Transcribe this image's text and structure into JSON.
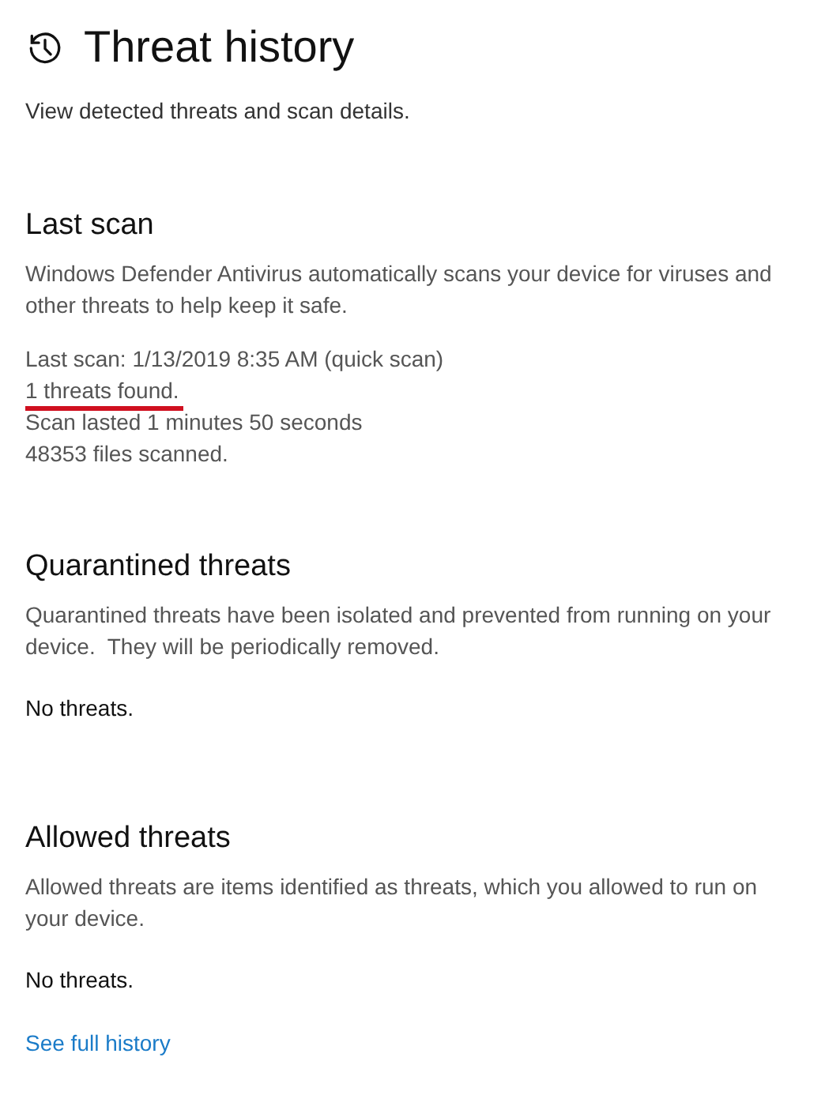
{
  "page": {
    "title": "Threat history",
    "subtitle": "View detected threats and scan details."
  },
  "last_scan": {
    "heading": "Last scan",
    "description": "Windows Defender Antivirus automatically scans your device for viruses and other threats to help keep it safe.",
    "details": [
      {
        "text": "Last scan: 1/13/2019 8:35 AM (quick scan)",
        "highlighted": false
      },
      {
        "text": "1 threats found.",
        "highlighted": true
      },
      {
        "text": "Scan lasted 1 minutes 50 seconds",
        "highlighted": false
      },
      {
        "text": "48353 files scanned.",
        "highlighted": false
      }
    ]
  },
  "quarantined_threats": {
    "heading": "Quarantined threats",
    "description": "Quarantined threats have been isolated and prevented from running on your device.  They will be periodically removed.",
    "status": "No threats."
  },
  "allowed_threats": {
    "heading": "Allowed threats",
    "description": "Allowed threats are items identified as threats, which you allowed to run on your device.",
    "status": "No threats."
  },
  "link": "See full history"
}
